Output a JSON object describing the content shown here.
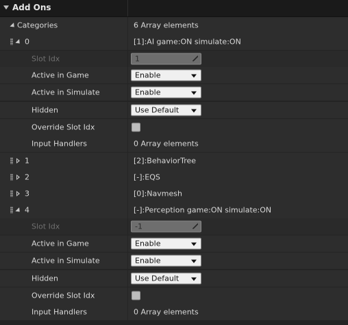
{
  "panel": {
    "title": "Add Ons"
  },
  "categories": {
    "label": "Categories",
    "value": "6 Array elements"
  },
  "element0": {
    "index": "0",
    "summary": "[1]:AI game:ON simulate:ON",
    "slot_idx_label": "Slot Idx",
    "slot_idx_value": "1",
    "active_in_game_label": "Active in Game",
    "active_in_game_value": "Enable",
    "active_in_simulate_label": "Active in Simulate",
    "active_in_simulate_value": "Enable",
    "hidden_label": "Hidden",
    "hidden_value": "Use Default",
    "override_slot_idx_label": "Override Slot Idx",
    "input_handlers_label": "Input Handlers",
    "input_handlers_value": "0 Array elements"
  },
  "element1": {
    "index": "1",
    "summary": "[2]:BehaviorTree"
  },
  "element2": {
    "index": "2",
    "summary": "[-]:EQS"
  },
  "element3": {
    "index": "3",
    "summary": "[0]:Navmesh"
  },
  "element4": {
    "index": "4",
    "summary": "[-]:Perception game:ON simulate:ON",
    "slot_idx_label": "Slot Idx",
    "slot_idx_value": "-1",
    "active_in_game_label": "Active in Game",
    "active_in_game_value": "Enable",
    "active_in_simulate_label": "Active in Simulate",
    "active_in_simulate_value": "Enable",
    "hidden_label": "Hidden",
    "hidden_value": "Use Default",
    "override_slot_idx_label": "Override Slot Idx",
    "input_handlers_label": "Input Handlers",
    "input_handlers_value": "0 Array elements"
  },
  "icons": {
    "section": "chevron-down-icon",
    "expanded": "expanded-arrow-icon",
    "collapsed": "collapsed-arrow-icon",
    "drag": "drag-handle-icon"
  },
  "colors": {
    "background": "#242424",
    "row": "#2d2d2d",
    "header": "#1a1a1a",
    "text": "#d8d8d8",
    "faded_text": "#6f6f6f",
    "dropdown": "#f0f0f0"
  }
}
